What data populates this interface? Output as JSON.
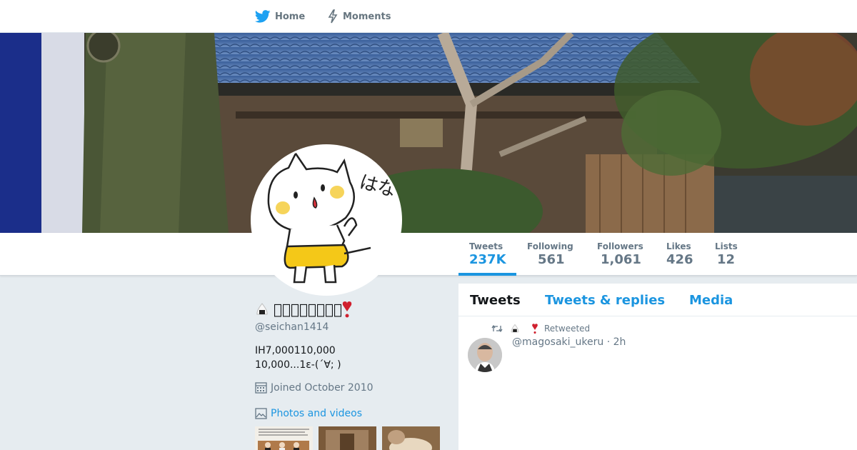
{
  "nav": {
    "home_label": "Home",
    "moments_label": "Moments"
  },
  "profile": {
    "display_name": "􏰀􏰀􏰀􏰀􏰀􏰀􏰀􏰀",
    "handle": "@seichan1414",
    "bio_line1": "IH7,000110,000",
    "bio_line2": "10,000...1ε-(´∀; )",
    "joined": "Joined October 2010",
    "photos_label": "Photos and videos",
    "avatar_text": "はな"
  },
  "stats": [
    {
      "label": "Tweets",
      "value": "237K"
    },
    {
      "label": "Following",
      "value": "561"
    },
    {
      "label": "Followers",
      "value": "1,061"
    },
    {
      "label": "Likes",
      "value": "426"
    },
    {
      "label": "Lists",
      "value": "12"
    }
  ],
  "tabs": [
    {
      "label": "Tweets"
    },
    {
      "label": "Tweets & replies"
    },
    {
      "label": "Media"
    }
  ],
  "tweet": {
    "retweet_label": "Retweeted",
    "handle": "@magosaki_ukeru",
    "time": "· 2h"
  },
  "colors": {
    "accent": "#1b95e0",
    "muted": "#657786",
    "background": "#e6ecf0"
  }
}
